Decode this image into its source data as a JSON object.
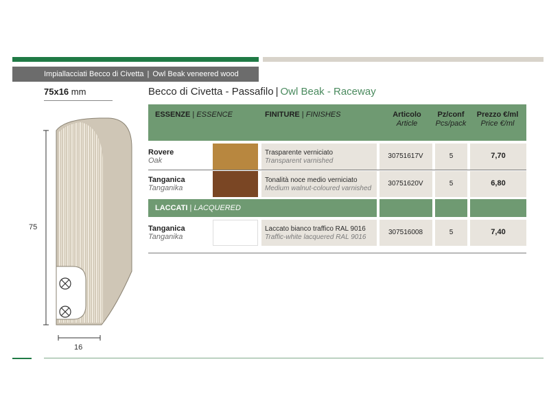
{
  "header": {
    "section_it": "Impiallacciati Becco di Civetta",
    "separator": "|",
    "section_en": "Owl Beak veneered wood"
  },
  "profile": {
    "size_bold": "75x16",
    "size_unit": "mm",
    "height_label": "75",
    "width_label": "16"
  },
  "title": {
    "it": "Becco di Civetta - Passafilo",
    "separator": "|",
    "en": "Owl Beak - Raceway"
  },
  "table": {
    "columns": {
      "essence_it": "ESSENZE",
      "essence_sep": "|",
      "essence_en": "ESSENCE",
      "finish_it": "FINITURE",
      "finish_sep": "|",
      "finish_en": "FINISHES",
      "article_it": "Articolo",
      "article_en": "Article",
      "pcs_it": "Pz/conf",
      "pcs_en": "Pcs/pack",
      "price_it": "Prezzo €/ml",
      "price_en": "Price €/ml"
    },
    "rows": [
      {
        "name_it": "Rovere",
        "name_en": "Oak",
        "swatch_color": "#b8873f",
        "finish_it": "Trasparente verniciato",
        "finish_en": "Transparent varnished",
        "code": "30751617V",
        "pcs": "5",
        "price": "7,70"
      },
      {
        "name_it": "Tanganica",
        "name_en": "Tanganika",
        "swatch_color": "#7a4624",
        "finish_it": "Tonalità noce medio verniciato",
        "finish_en": "Medium walnut-coloured varnished",
        "code": "30751620V",
        "pcs": "5",
        "price": "6,80"
      }
    ],
    "lacquered_section": {
      "label_it": "LACCATI",
      "separator": "|",
      "label_en": "LACQUERED"
    },
    "lacquered_rows": [
      {
        "name_it": "Tanganica",
        "name_en": "Tanganika",
        "swatch_color": "#ffffff",
        "finish_it": "Laccato bianco traffico RAL 9016",
        "finish_en": "Traffic-white lacquered RAL 9016",
        "code": "307516008",
        "pcs": "5",
        "price": "7,40"
      }
    ]
  },
  "colors": {
    "brand_green": "#1f7a45",
    "table_green": "#6f9a72",
    "cell_grey": "#e8e4dd",
    "header_grey": "#6c6c6c"
  }
}
